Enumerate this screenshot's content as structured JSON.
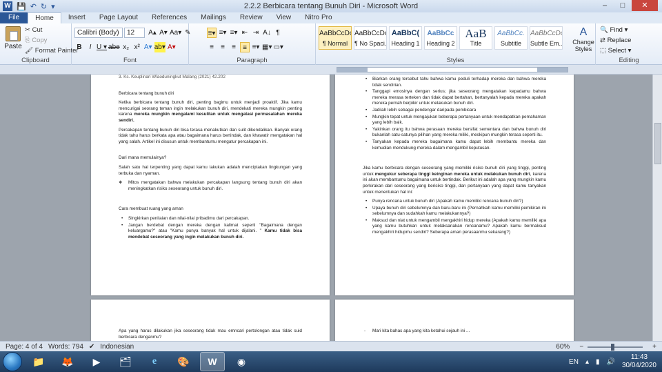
{
  "window": {
    "title": "2.2.2 Berbicara tentang Bunuh Diri  -  Microsoft Word",
    "app_icon": "W",
    "controls": {
      "minimize": "–",
      "maximize": "□",
      "close": "✕"
    }
  },
  "qat": [
    "💾",
    "↶",
    "↻",
    "▾"
  ],
  "tabs": [
    "File",
    "Home",
    "Insert",
    "Page Layout",
    "References",
    "Mailings",
    "Review",
    "View",
    "Nitro Pro"
  ],
  "active_tab": "Home",
  "ribbon": {
    "clipboard": {
      "paste": "Paste",
      "cut": "Cut",
      "copy": "Copy",
      "format_painter": "Format Painter",
      "label": "Clipboard"
    },
    "font": {
      "name": "Calibri (Body)",
      "size": "12",
      "label": "Font",
      "row1": [
        "A▴",
        "A▾",
        "Aa▾",
        "✎"
      ],
      "row2": [
        "B",
        "I",
        "U ▾",
        "abe",
        "x₂",
        "x²",
        "A▾",
        "ab▾",
        "A▾"
      ]
    },
    "paragraph": {
      "label": "Paragraph",
      "row1": [
        "≡▾",
        "≡▾",
        "≡▾",
        "⇤",
        "⇥",
        "A↓",
        "¶"
      ],
      "row2": [
        "≡",
        "≡",
        "≡",
        "≡",
        "≡▾",
        "▦▾",
        "▭▾"
      ]
    },
    "styles": {
      "label": "Styles",
      "items": [
        {
          "preview": "AaBbCcDc",
          "name": "¶ Normal"
        },
        {
          "preview": "AaBbCcDc",
          "name": "¶ No Spaci..."
        },
        {
          "preview": "AaBbC(",
          "name": "Heading 1"
        },
        {
          "preview": "AaBbCc",
          "name": "Heading 2"
        },
        {
          "preview": "AaB",
          "name": "Title"
        },
        {
          "preview": "AaBbCc.",
          "name": "Subtitle"
        },
        {
          "preview": "AaBbCcDc",
          "name": "Subtle Em..."
        }
      ],
      "change": "Change Styles"
    },
    "editing": {
      "find": "Find ▾",
      "replace": "Replace",
      "select": "Select ▾",
      "label": "Editing"
    }
  },
  "pages": {
    "left": {
      "top_line": "3.   Ks. Keuplinari Wlaoduningkut Malang (2021) 42.202",
      "heading": "Berbicara tentang bunuh diri",
      "p1_a": "Ketika berbicara tentang bunuh diri, penting bagimu untuk menjadi proaktif. Jika kamu mencurigai seorang teman ingin melakukan bunuh diri, mendekati mereka mungkin penting karena ",
      "p1_b": "mereka mungkin mengalami kesulitan untuk mengatasi permasalahan mereka sendiri.",
      "p2": "Percakapan tentang bunuh diri bisa terasa menakutkan dan sulit dikendalikan. Banyak orang tidak tahu harus berkata apa atau bagaimana harus bertindak, dan khawatir mengatakan hal yang salah. Artikel ini disusun untuk membantumu mengatur percakapan ini.",
      "h2": "Dari mana memulainya?",
      "p3": "Salah satu hal terpenting yang dapat kamu lakukan adalah menciptakan lingkungan yang terbuka dan nyaman.",
      "diamond": "Mitos mengatakan bahwa melakukan percakapan langsung tentang bunuh diri akan meningkatkan risiko seseorang untuk bunuh diri.",
      "h3": "Cara membuat ruang yang aman",
      "b1": "Singkirkan penilaian dan nilai-nilai pribadimu dari percakapan.",
      "b2_a": "Jangan berdebat dengan mereka dengan kalimat seperti \"Bagaimana dengan keluargamu?\" atau \"Kamu punya banyak hal untuk dijalani. \" ",
      "b2_b": "Kamu tidak bisa mendebat seseorang yang ingin melakukan bunuh diri."
    },
    "right": {
      "items": [
        "Biarkan orang tersebut tahu bahwa kamu peduli terhadap mereka dan bahwa mereka tidak sendirian.",
        "Tanggapi emosinya dengan serius; jika seseorang mengatakan kepadamu bahwa mereka merasa terteken dan tidak dapat bertahan, bertanyalah kepada mereka apakah mereka pernah berpikir untuk melakukan bunuh diri.",
        "Jadilah lebih sebagai pendengar daripada pembicara",
        "Mungkin tepat untuk mengajukan beberapa pertanyaan untuk mendapatkan pemahaman yang lebih baik.",
        "Yakinkan orang itu bahwa perasaan mereka bersifat sementara dan bahwa bunuh diri bukanlah satu-satunya pilihan yang mereka miliki, meskipun mungkin terasa seperti itu.",
        "Tanyakan kepada mereka bagaimana kamu dapat lebih membantu mereka dan kemudian mendukung mereka dalam mengambil keputusan."
      ],
      "p_a": "Jika kamu berbicara dengan seseorang yang memiliki risiko bunuh diri yang tinggi, penting untuk ",
      "p_b": "mengukur seberapa tinggi keinginan mereka untuk melakukan bunuh diri",
      "p_c": ", karena ini akan membantumu bagaimana untuk bertindak. Berikut ini adalah apa yang mungkin kamu perkirakan dari seseorang yang berisiko tinggi, dan pertanyaan yang dapat kamu tanyakan untuk menentukan hal ini:",
      "items2": [
        "Punya rencana untuk bunuh diri (Apakah kamu memiliki rencana bunuh diri?)",
        "Upaya bunuh diri sebelumnya dan baru-baru ini (Pernahkah kamu memiliki pemikiran ini sebelumnya dan sudahkah kamu melakukannya?)",
        "Maksud dan niat untuk mengambil mengakhiri hidup mereka (Apakah kamu memiliki apa yang kamu butuhkan untuk melaksanakan rencanamu? Apakah kamu bermaksud mengakhiri hidupmu sendiri? Seberapa aman perasaanmu sekarang?)"
      ]
    },
    "bottom_left": "Apa yang harus dilakukan jika seseorang tidak mau emncari pertolongan atau tidak suid berbicara denganmu?",
    "bottom_right": "Mari kita bahas apa yang kita ketahui sejauh ini ..."
  },
  "status": {
    "page": "Page: 4 of 4",
    "words": "Words: 794",
    "language": "Indonesian",
    "zoom": "60%",
    "zoom_fraction": 0.6
  },
  "taskbar": {
    "icons": [
      "📁",
      "🦊",
      "▶",
      "🗂",
      "e",
      "🎨",
      "W",
      "◉"
    ],
    "active_index": 6,
    "lang": "EN",
    "time": "11:43",
    "date": "30/04/2020"
  }
}
